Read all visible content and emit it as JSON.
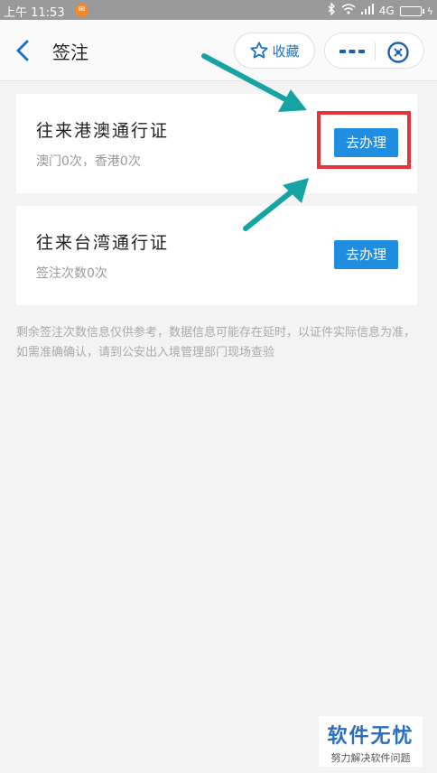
{
  "status_bar": {
    "time": "上午 11:53",
    "network": "4G"
  },
  "header": {
    "title": "签注",
    "favorite_label": "收藏"
  },
  "cards": [
    {
      "title": "往来港澳通行证",
      "subtitle": "澳门0次，香港0次",
      "button": "去办理"
    },
    {
      "title": "往来台湾通行证",
      "subtitle": "签注次数0次",
      "button": "去办理"
    }
  ],
  "notice": "剩余签注次数信息仅供参考，数据信息可能存在延时，以证件实际信息为准，如需准确确认，请到公安出入境管理部门现场查验",
  "watermark": {
    "main": "软件无忧",
    "sub": "努力解决软件问题"
  },
  "colors": {
    "accent": "#1f8de0",
    "highlight": "#e8323a",
    "arrow": "#16a3a3"
  }
}
